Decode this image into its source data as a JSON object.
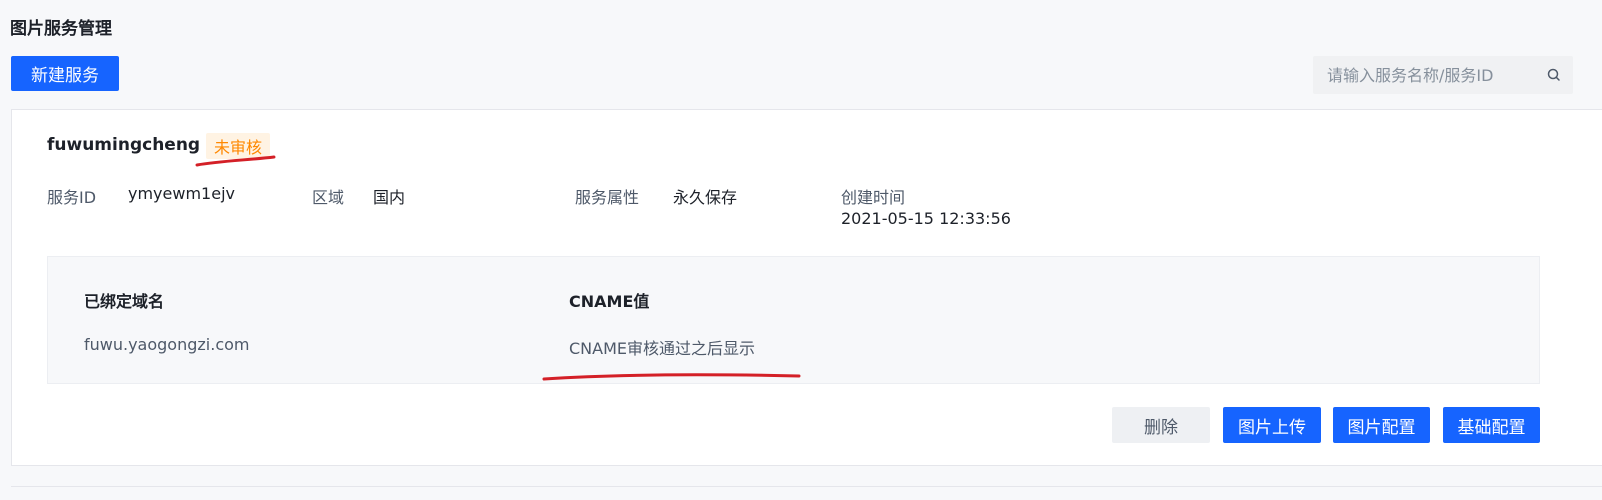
{
  "page": {
    "title": "图片服务管理"
  },
  "toolbar": {
    "create_label": "新建服务"
  },
  "search": {
    "placeholder": "请输入服务名称/服务ID",
    "icon": "search-icon"
  },
  "service": {
    "name": "fuwumingcheng",
    "status": "未审核",
    "status_color": "#ff8800",
    "id_label": "服务ID",
    "id_value": "ymyewm1ejv",
    "region_label": "区域",
    "region_value": "国内",
    "attr_label": "服务属性",
    "attr_value": "永久保存",
    "created_label": "创建时间",
    "created_value": "2021-05-15 12:33:56"
  },
  "domains": {
    "header_domain": "已绑定域名",
    "header_cname": "CNAME值",
    "domain_value": "fuwu.yaogongzi.com",
    "cname_value": "CNAME审核通过之后显示"
  },
  "actions": {
    "delete_label": "删除",
    "upload_label": "图片上传",
    "image_config_label": "图片配置",
    "base_config_label": "基础配置"
  },
  "colors": {
    "primary": "#1664ff",
    "annotation": "#d42027"
  }
}
